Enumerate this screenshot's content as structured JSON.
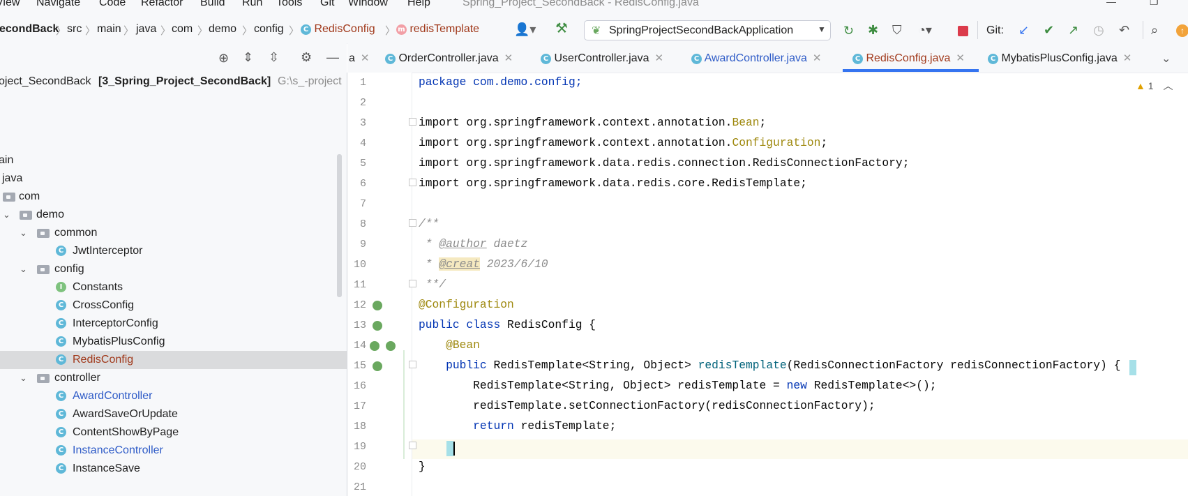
{
  "window": {
    "title": "Spring_Project_SecondBack - RedisConfig.java"
  },
  "menu": [
    "View",
    "Navigate",
    "Code",
    "Refactor",
    "Build",
    "Run",
    "Tools",
    "Git",
    "Window",
    "Help"
  ],
  "breadcrumb": [
    "econdBack",
    "src",
    "main",
    "java",
    "com",
    "demo",
    "config",
    "RedisConfig",
    "redisTemplate"
  ],
  "toolbar": {
    "run_config": "SpringProjectSecondBackApplication",
    "git_label": "Git:"
  },
  "project": {
    "root_label": "oject_SecondBack",
    "root_module": "[3_Spring_Project_SecondBack]",
    "root_path": "G:\\s_-project",
    "tree": [
      {
        "label": "ain"
      },
      {
        "label": "java"
      },
      {
        "label": "com"
      },
      {
        "label": "demo"
      },
      {
        "label": "common"
      },
      {
        "label": "JwtInterceptor"
      },
      {
        "label": "config"
      },
      {
        "label": "Constants"
      },
      {
        "label": "CrossConfig"
      },
      {
        "label": "InterceptorConfig"
      },
      {
        "label": "MybatisPlusConfig"
      },
      {
        "label": "RedisConfig"
      },
      {
        "label": "controller"
      },
      {
        "label": "AwardController"
      },
      {
        "label": "AwardSaveOrUpdate"
      },
      {
        "label": "ContentShowByPage"
      },
      {
        "label": "InstanceController"
      },
      {
        "label": "InstanceSave"
      }
    ]
  },
  "tabs": [
    {
      "label": "a"
    },
    {
      "label": "OrderController.java"
    },
    {
      "label": "UserController.java"
    },
    {
      "label": "AwardController.java"
    },
    {
      "label": "RedisConfig.java"
    },
    {
      "label": "MybatisPlusConfig.java"
    }
  ],
  "editor": {
    "warning_count": "1",
    "line_numbers": [
      "1",
      "2",
      "3",
      "4",
      "5",
      "6",
      "7",
      "8",
      "9",
      "10",
      "11",
      "12",
      "13",
      "14",
      "15",
      "16",
      "17",
      "18",
      "19",
      "20",
      "21"
    ],
    "code": {
      "l1": "package com.demo.config;",
      "l3a": "import org.springframework.context.annotation.",
      "l3b": "Bean",
      "l4a": "import org.springframework.context.annotation.",
      "l4b": "Configuration",
      "l5": "import org.springframework.data.redis.connection.RedisConnectionFactory;",
      "l6": "import org.springframework.data.redis.core.RedisTemplate;",
      "l8": "/**",
      "l9a": " * ",
      "l9tag": "@author",
      "l9b": " daetz",
      "l10a": " * ",
      "l10tag": "@creat",
      "l10b": " 2023/6/10",
      "l11": " **/",
      "l12": "@Configuration",
      "l13a": "public class",
      "l13b": " RedisConfig {",
      "l14": "    @Bean",
      "l15a": "    public",
      "l15b": " RedisTemplate<String, Object> ",
      "l15c": "redisTemplate",
      "l15d": "(RedisConnectionFactory redisConnectionFactory) {",
      "l16a": "        RedisTemplate<String, Object> redisTemplate = ",
      "l16b": "new",
      "l16c": " RedisTemplate<>();",
      "l17": "        redisTemplate.setConnectionFactory(redisConnectionFactory);",
      "l18a": "        return",
      "l18b": " redisTemplate;",
      "l19": "    }",
      "l20": "}"
    }
  },
  "colors": {
    "accent": "#3574f0",
    "keyword": "#0033b3",
    "annotation": "#9e880d",
    "class_icon": "#5fb8d8",
    "selected_file": "#a0381a",
    "linked_file": "#2e5bc7"
  }
}
